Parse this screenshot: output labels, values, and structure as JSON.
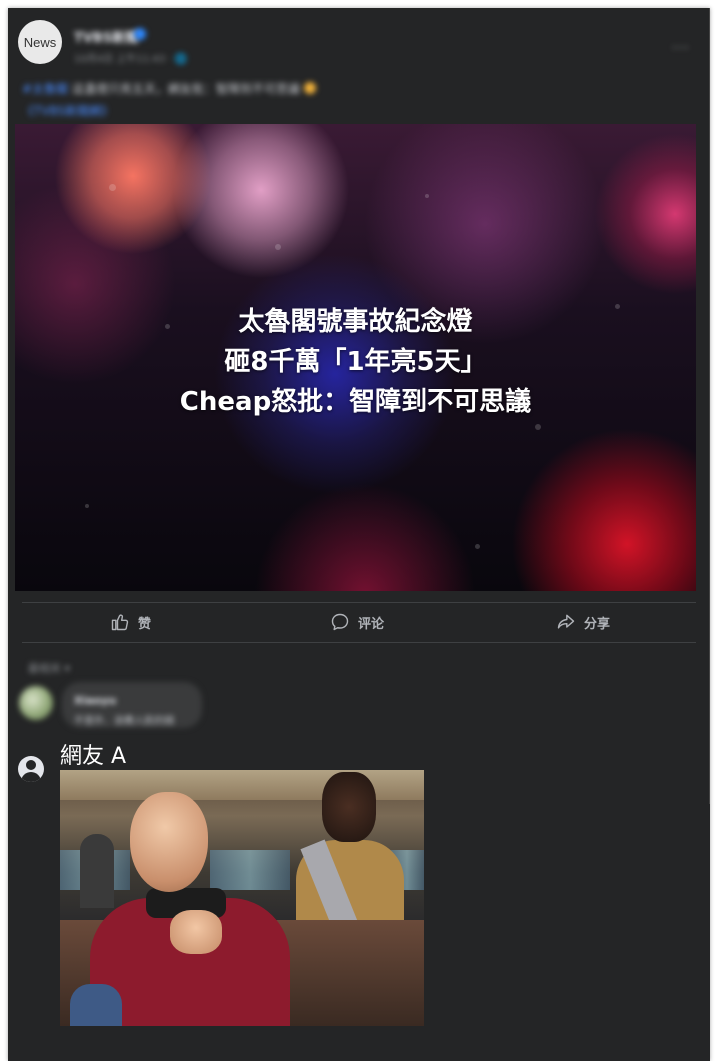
{
  "post": {
    "avatar_label": "News",
    "page_name": "TVBS新聞",
    "post_time": "10月4日 上午11:43 · 🌐",
    "caption_tag": "#太魯閣",
    "caption_text": "這盞燈只亮五天，網友批：智障到不可思議",
    "caption_line2": "《TVBS新聞網》",
    "more_icon": "···"
  },
  "hero": {
    "headline_line1": "太魯閣號事故紀念燈",
    "headline_line2": "砸8千萬「1年亮5天」",
    "headline_line3": "Cheap怒批：智障到不可思議"
  },
  "actions": {
    "like_label": "赞",
    "comment_label": "评论",
    "share_label": "分享"
  },
  "comments": {
    "sort_label": "最相关 ▾",
    "first_name": "Xiaoyu",
    "first_text": "不意外．浪費人民的錢",
    "user_name": "網友 A"
  },
  "colors": {
    "card_bg": "#242526",
    "text_primary": "#e4e6eb",
    "text_secondary": "#b0b3b8",
    "link_blue": "#2d88ff"
  }
}
